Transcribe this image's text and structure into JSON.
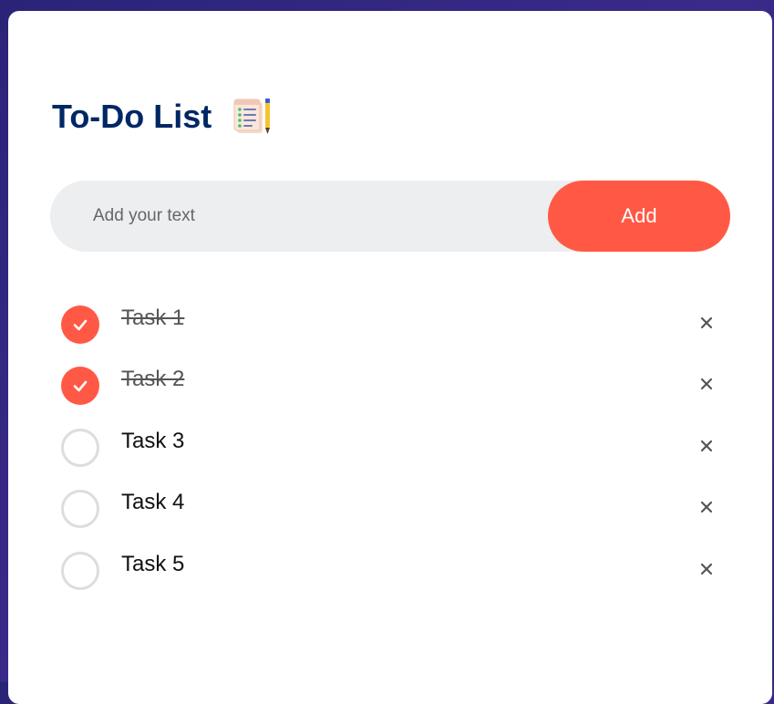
{
  "app": {
    "title": "To-Do List",
    "title_icon": "notepad-checklist-icon"
  },
  "input": {
    "placeholder": "Add your text",
    "value": "",
    "add_label": "Add"
  },
  "tasks": [
    {
      "label": "Task 1",
      "completed": true
    },
    {
      "label": "Task 2",
      "completed": true
    },
    {
      "label": "Task 3",
      "completed": false
    },
    {
      "label": "Task 4",
      "completed": false
    },
    {
      "label": "Task 5",
      "completed": false
    }
  ],
  "icons": {
    "check": "check-icon",
    "remove": "close-icon"
  },
  "colors": {
    "accent": "#ff5945",
    "title": "#002765",
    "input_bg": "#edeef0",
    "background": "#2a2478"
  }
}
